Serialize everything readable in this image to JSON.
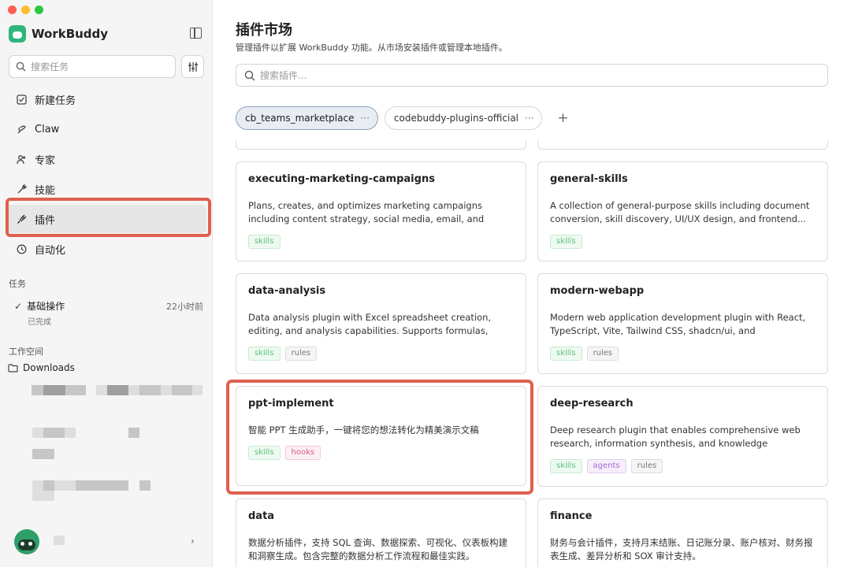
{
  "app": {
    "name": "WorkBuddy"
  },
  "colors": {
    "accent_highlight": "#e0604f",
    "brand_green": "#2fb67b",
    "traffic_red": "#ff5f57",
    "traffic_yellow": "#febc2e",
    "traffic_green": "#28c840"
  },
  "sidebar": {
    "search_placeholder": "搜索任务",
    "nav": [
      {
        "label": "新建任务",
        "icon": "new-task-icon"
      },
      {
        "label": "Claw",
        "icon": "claw-icon"
      },
      {
        "label": "专家",
        "icon": "experts-icon"
      },
      {
        "label": "技能",
        "icon": "skills-icon"
      },
      {
        "label": "插件",
        "icon": "plugin-icon",
        "active": true
      },
      {
        "label": "自动化",
        "icon": "automation-icon"
      }
    ],
    "tasks_label": "任务",
    "task": {
      "name": "基础操作",
      "time": "22小时前",
      "status": "已完成"
    },
    "workspace_label": "工作空间",
    "folder": "Downloads"
  },
  "main": {
    "title": "插件市场",
    "subtitle": "管理插件以扩展 WorkBuddy 功能。从市场安装插件或管理本地插件。",
    "search_placeholder": "搜索插件...",
    "tabs": [
      {
        "label": "cb_teams_marketplace",
        "active": true
      },
      {
        "label": "codebuddy-plugins-official",
        "active": false
      }
    ],
    "cards": [
      {
        "title": "executing-marketing-campaigns",
        "desc": "Plans, creates, and optimizes marketing campaigns including content strategy, social media, email, and analytics",
        "tags": [
          "skills"
        ]
      },
      {
        "title": "general-skills",
        "desc": "A collection of general-purpose skills including document conversion, skill discovery, UI/UX design, and frontend...",
        "tags": [
          "skills"
        ]
      },
      {
        "title": "data-analysis",
        "desc": "Data analysis plugin with Excel spreadsheet creation, editing, and analysis capabilities. Supports formulas, formatting, dat...",
        "tags": [
          "skills",
          "rules"
        ]
      },
      {
        "title": "modern-webapp",
        "desc": "Modern web application development plugin with React, TypeScript, Vite, Tailwind CSS, shadcn/ui, and comprehensi...",
        "tags": [
          "skills",
          "rules"
        ]
      },
      {
        "title": "ppt-implement",
        "desc": "智能 PPT 生成助手，一键将您的想法转化为精美演示文稿",
        "tags": [
          "skills",
          "hooks"
        ]
      },
      {
        "title": "deep-research",
        "desc": "Deep research plugin that enables comprehensive web research, information synthesis, and knowledge discovery....",
        "tags": [
          "skills",
          "agents",
          "rules"
        ]
      },
      {
        "title": "data",
        "desc": "数据分析插件，支持 SQL 查询、数据探索、可视化、仪表板构建和洞察生成。包含完整的数据分析工作流程和最佳实践。",
        "tags": []
      },
      {
        "title": "finance",
        "desc": "财务与会计插件，支持月末结账、日记账分录、账户核对、财务报表生成、差异分析和 SOX 审计支持。",
        "tags": []
      }
    ]
  }
}
